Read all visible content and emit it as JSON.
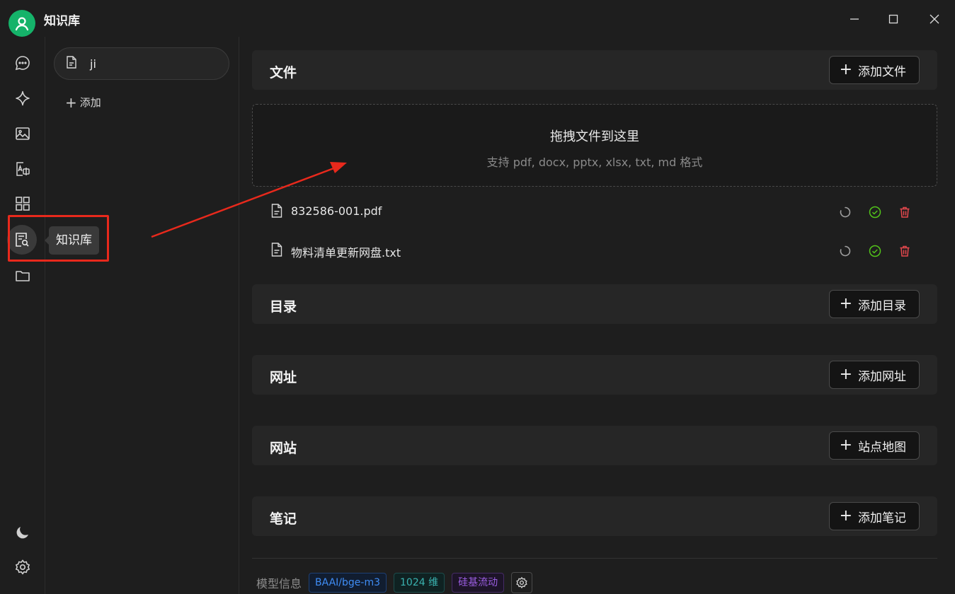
{
  "app": {
    "title": "知识库"
  },
  "window_controls": [
    "minimize-icon",
    "maximize-icon",
    "close-icon"
  ],
  "rail": {
    "items": [
      "chat-icon",
      "sparkle-icon",
      "image-icon",
      "translate-icon",
      "apps-grid-icon",
      "knowledge-base-icon",
      "folder-icon"
    ],
    "bottom": [
      "moon-icon",
      "settings-icon"
    ],
    "active": "knowledge-base-icon",
    "tooltip": "知识库"
  },
  "kb_panel": {
    "items": [
      {
        "label": "ji"
      }
    ],
    "add_label": "添加"
  },
  "sections": {
    "files": {
      "title": "文件",
      "button": "添加文件"
    },
    "dirs": {
      "title": "目录",
      "button": "添加目录"
    },
    "urls": {
      "title": "网址",
      "button": "添加网址"
    },
    "sites": {
      "title": "网站",
      "button": "站点地图"
    },
    "notes": {
      "title": "笔记",
      "button": "添加笔记"
    }
  },
  "dropzone": {
    "title": "拖拽文件到这里",
    "subtitle": "支持 pdf, docx, pptx, xlsx, txt, md 格式"
  },
  "files": [
    {
      "name": "832586-001.pdf",
      "actions": [
        "refresh-icon",
        "check-circle-icon",
        "trash-icon"
      ]
    },
    {
      "name": "物料清单更新网盘.txt",
      "actions": [
        "refresh-icon",
        "check-circle-icon",
        "trash-icon"
      ]
    }
  ],
  "footer": {
    "label": "模型信息",
    "model_tag": "BAAI/bge-m3",
    "dim_tag": "1024 维",
    "provider_tag": "硅基流动"
  },
  "colors": {
    "accent_green": "#15b36a",
    "highlight_red": "#e8291c",
    "check_green": "#52c41a",
    "delete_red": "#e5484d"
  }
}
